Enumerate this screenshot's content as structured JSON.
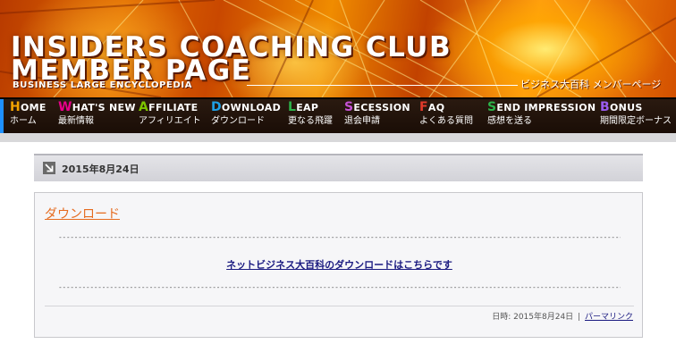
{
  "banner": {
    "title_line1": "INSIDERS COACHING CLUB",
    "title_line2": "MEMBER PAGE",
    "subtitle": "BUSINESS LARGE ENCYCLOPEDIA",
    "member_label": "ビジネス大百科 メンバーページ"
  },
  "nav": {
    "accent_color": "#1e90ff",
    "items": [
      {
        "first": "H",
        "rest": "OME",
        "jp": "ホーム",
        "letter_color": "#f4a300"
      },
      {
        "first": "W",
        "rest": "HAT'S NEW",
        "jp": "最新情報",
        "letter_color": "#e8008a"
      },
      {
        "first": "A",
        "rest": "FFILIATE",
        "jp": "アフィリエイト",
        "letter_color": "#7cc400"
      },
      {
        "first": "D",
        "rest": "OWNLOAD",
        "jp": "ダウンロード",
        "letter_color": "#1ea0e6"
      },
      {
        "first": "L",
        "rest": "EAP",
        "jp": "更なる飛躍",
        "letter_color": "#2cb34a"
      },
      {
        "first": "S",
        "rest": "ECESSION",
        "jp": "退会申請",
        "letter_color": "#c452d4"
      },
      {
        "first": "F",
        "rest": "AQ",
        "jp": "よくある質問",
        "letter_color": "#e23a2a"
      },
      {
        "first": "S",
        "rest": "END IMPRESSION",
        "jp": "感想を送る",
        "letter_color": "#2cb34a"
      },
      {
        "first": "B",
        "rest": "ONUS",
        "jp": "期間限定ボーナス",
        "letter_color": "#9b5cf0"
      }
    ]
  },
  "date_header": {
    "text": "2015年8月24日"
  },
  "post": {
    "title": "ダウンロード",
    "title_color": "#e56b1f",
    "dashes": "------------------------------------------------------------------------------------------------------------------------------------------------------------------------------------------------------------------------",
    "link_text": "ネットビジネス大百科のダウンロードはこちらです",
    "meta_date": "日時: 2015年8月24日",
    "meta_separator": "|",
    "permalink": "パーマリンク"
  }
}
